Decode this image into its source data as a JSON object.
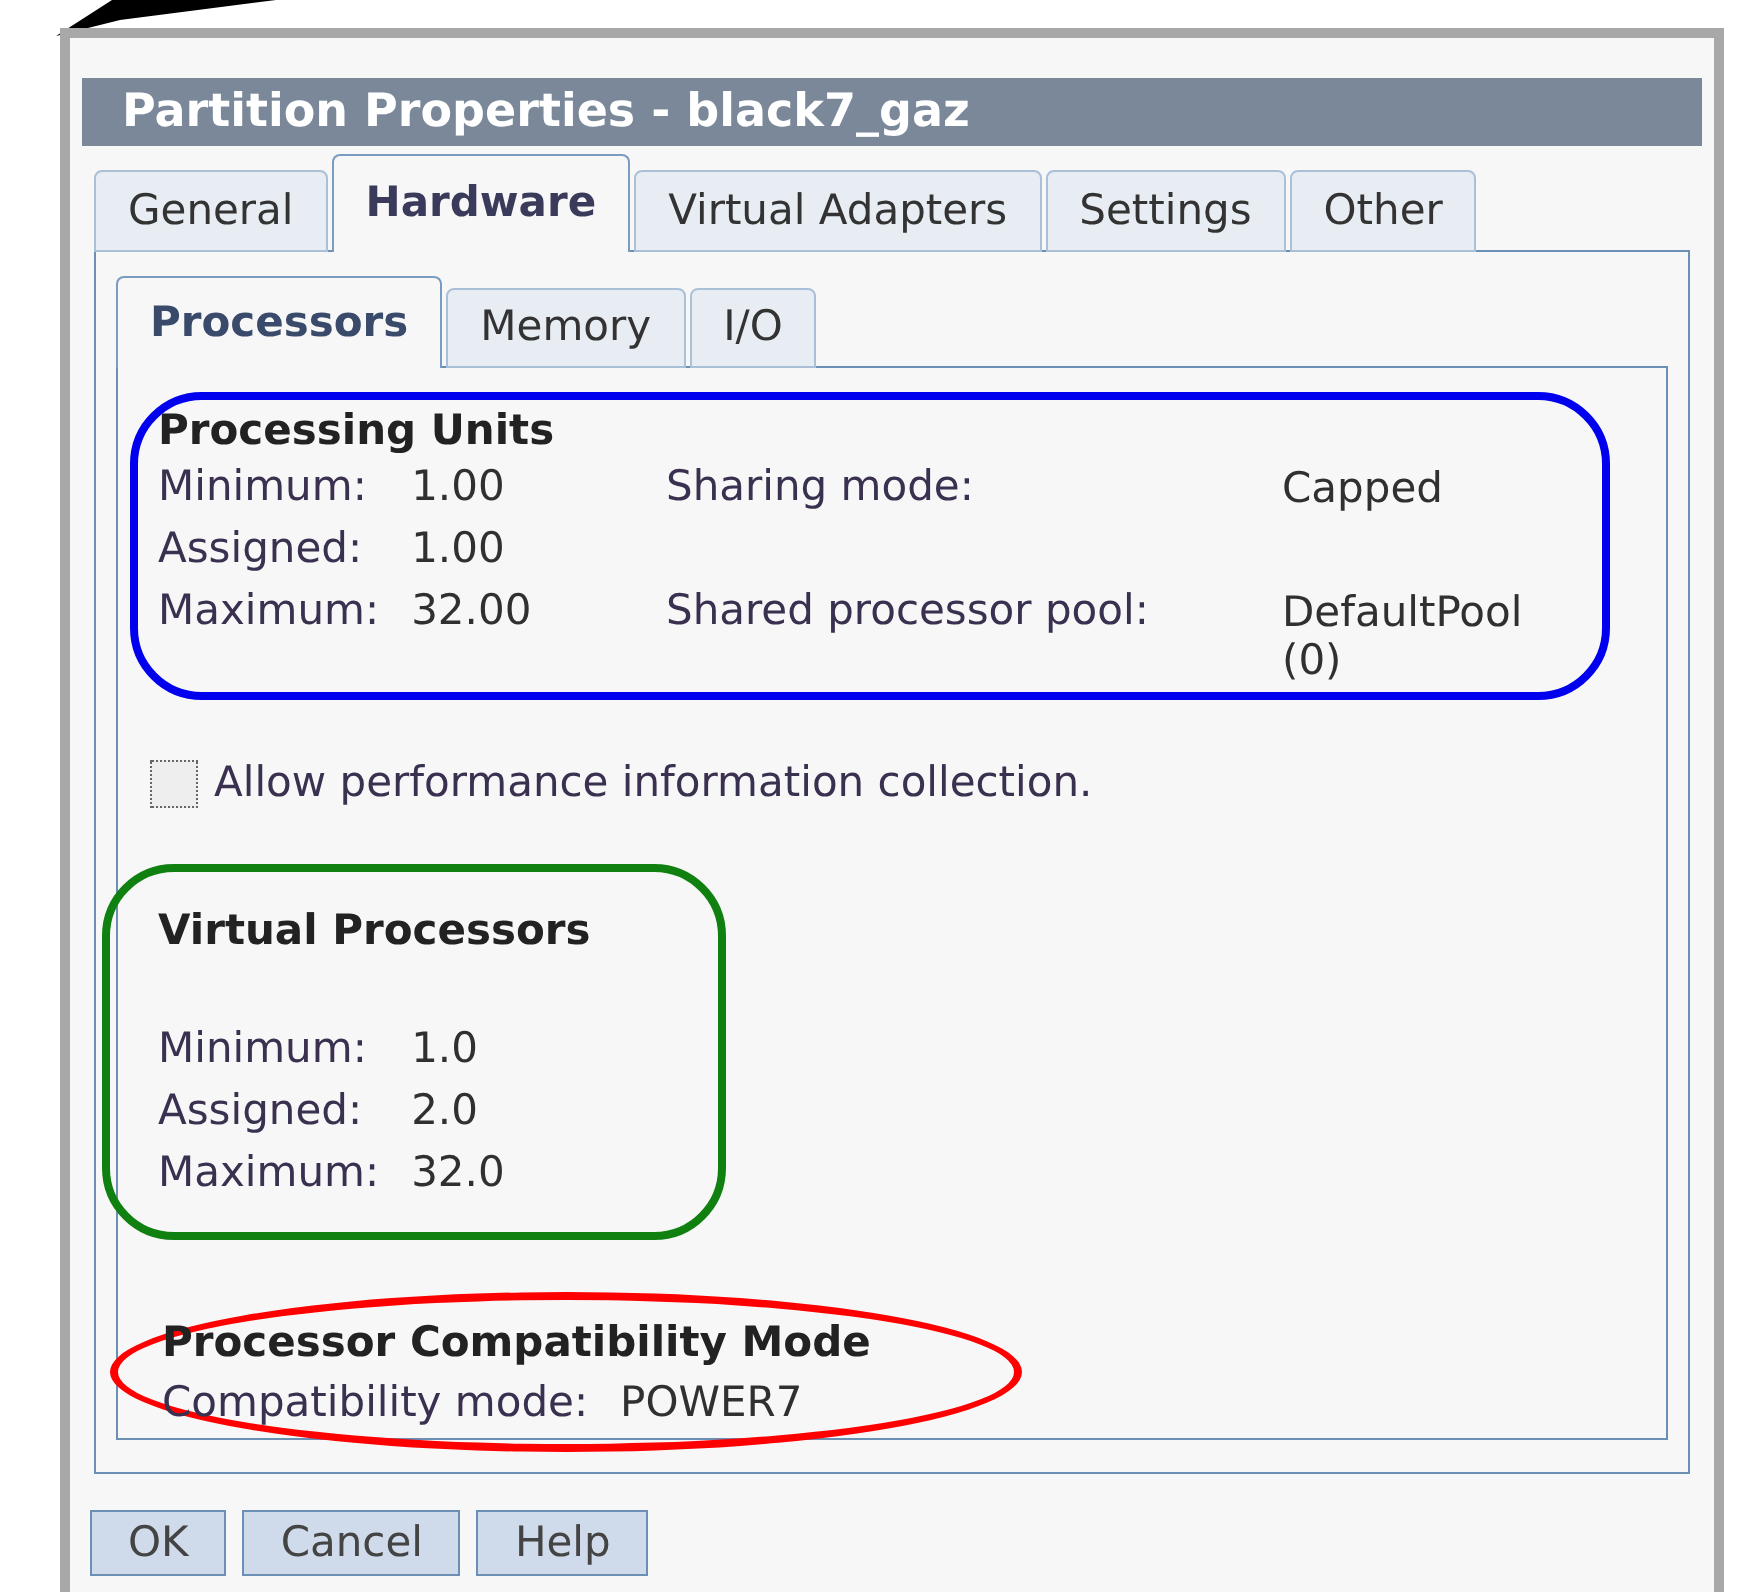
{
  "window": {
    "title": "Partition Properties - black7_gaz"
  },
  "tabs": [
    {
      "label": "General",
      "selected": false
    },
    {
      "label": "Hardware",
      "selected": true
    },
    {
      "label": "Virtual Adapters",
      "selected": false
    },
    {
      "label": "Settings",
      "selected": false
    },
    {
      "label": "Other",
      "selected": false
    }
  ],
  "subtabs": [
    {
      "label": "Processors",
      "selected": true
    },
    {
      "label": "Memory",
      "selected": false
    },
    {
      "label": "I/O",
      "selected": false
    }
  ],
  "processing_units": {
    "title": "Processing Units",
    "color": "#0000ee",
    "rows": [
      {
        "label": "Minimum:",
        "value": "1.00"
      },
      {
        "label": "Assigned:",
        "value": "1.00"
      },
      {
        "label": "Maximum:",
        "value": "32.00"
      }
    ],
    "sharing": [
      {
        "label": "Sharing mode:",
        "value": "Capped"
      },
      {
        "label": "Shared processor pool:",
        "value": "DefaultPool (0)"
      }
    ]
  },
  "performance_collection": {
    "label": "Allow performance information collection.",
    "checked": false
  },
  "virtual_processors": {
    "title": "Virtual Processors",
    "color": "#108010",
    "rows": [
      {
        "label": "Minimum:",
        "value": "1.0"
      },
      {
        "label": "Assigned:",
        "value": "2.0"
      },
      {
        "label": "Maximum:",
        "value": "32.0"
      }
    ]
  },
  "compatibility": {
    "title": "Processor Compatibility Mode",
    "color": "#ff0000",
    "label": "Compatibility mode:",
    "value": "POWER7"
  },
  "buttons": [
    "OK",
    "Cancel",
    "Help"
  ]
}
